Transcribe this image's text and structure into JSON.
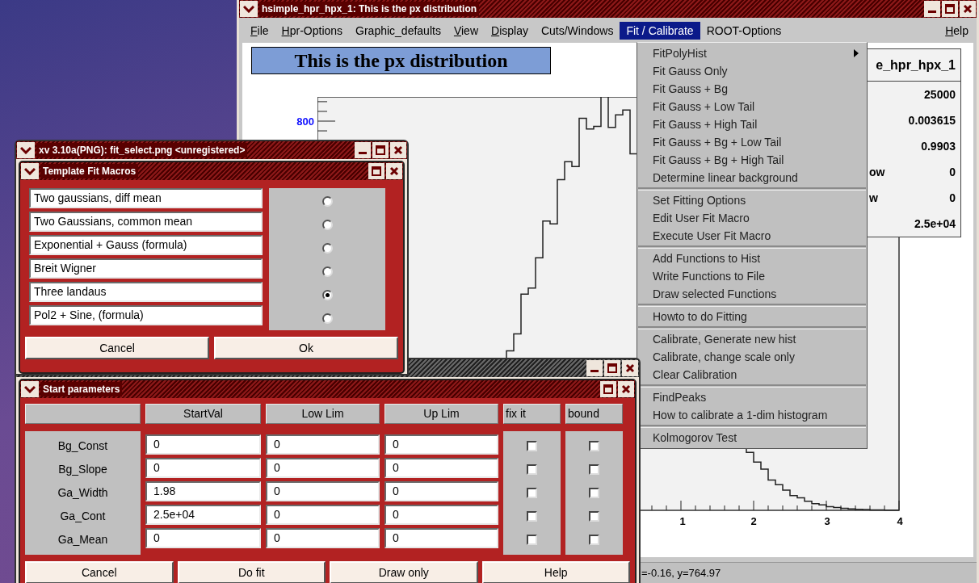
{
  "main_window": {
    "title": "hsimple_hpr_hpx_1: This is the px distribution",
    "menu_bar": [
      {
        "label": "File",
        "underline_first": true,
        "selected": false
      },
      {
        "label": "Hpr-Options",
        "underline_first": true,
        "selected": false
      },
      {
        "label": "Graphic_defaults",
        "underline_first": false,
        "selected": false
      },
      {
        "label": "View",
        "underline_first": true,
        "selected": false
      },
      {
        "label": "Display",
        "underline_first": true,
        "selected": false
      },
      {
        "label": "Cuts/Windows",
        "underline_first": false,
        "selected": false
      },
      {
        "label": "Fit / Calibrate",
        "underline_first": false,
        "selected": true
      },
      {
        "label": "ROOT-Options",
        "underline_first": false,
        "selected": false
      }
    ],
    "help_menu": {
      "label": "Help",
      "underline_first": true
    },
    "canvas": {
      "title_box": "This is the px distribution",
      "stats_box": {
        "title": "e_hpr_hpx_1",
        "rows": [
          {
            "value": "25000"
          },
          {
            "value": "0.003615"
          },
          {
            "value": "0.9903"
          },
          {
            "label": "ow",
            "value": "0"
          },
          {
            "label": "w",
            "value": "0"
          },
          {
            "value": "2.5e+04"
          }
        ]
      },
      "plot": {
        "y_tick_labels": [
          "800"
        ],
        "x_tick_labels": [
          "1",
          "2",
          "3",
          "4"
        ]
      }
    },
    "status_text": "=-0.16, y=764.97"
  },
  "fit_menu": {
    "groups": [
      [
        {
          "label": "FitPolyHist",
          "has_submenu": true
        },
        {
          "label": "Fit Gauss Only",
          "has_submenu": false
        },
        {
          "label": "Fit Gauss + Bg",
          "has_submenu": false
        },
        {
          "label": "Fit Gauss + Low Tail",
          "has_submenu": false
        },
        {
          "label": "Fit Gauss + High Tail",
          "has_submenu": false
        },
        {
          "label": "Fit Gauss + Bg + Low Tail",
          "has_submenu": false
        },
        {
          "label": "Fit Gauss + Bg + High Tail",
          "has_submenu": false
        },
        {
          "label": "Determine linear background",
          "has_submenu": false
        }
      ],
      [
        {
          "label": "Set Fitting Options",
          "has_submenu": false
        },
        {
          "label": "Edit User Fit Macro",
          "has_submenu": false
        },
        {
          "label": "Execute User Fit Macro",
          "has_submenu": false
        }
      ],
      [
        {
          "label": "Add Functions to Hist",
          "has_submenu": false
        },
        {
          "label": "Write Functions to File",
          "has_submenu": false
        },
        {
          "label": "Draw selected Functions",
          "has_submenu": false
        }
      ],
      [
        {
          "label": "Howto to do Fitting",
          "has_submenu": false
        }
      ],
      [
        {
          "label": "Calibrate, Generate new hist",
          "has_submenu": false
        },
        {
          "label": "Calibrate, change scale only",
          "has_submenu": false
        },
        {
          "label": "Clear Calibration",
          "has_submenu": false
        }
      ],
      [
        {
          "label": "FindPeaks",
          "has_submenu": false
        },
        {
          "label": "How to calibrate a 1-dim histogram",
          "has_submenu": false
        }
      ],
      [
        {
          "label": "Kolmogorov Test",
          "has_submenu": false
        }
      ]
    ]
  },
  "xv_window": {
    "title": "xv 3.10a(PNG): fit_select.png <unregistered>",
    "dialog": {
      "title": "Template Fit Macros",
      "macros": [
        {
          "name": "Two gaussians, diff mean",
          "selected": false
        },
        {
          "name": "Two Gaussians, common mean",
          "selected": false
        },
        {
          "name": "Exponential + Gauss (formula)",
          "selected": false
        },
        {
          "name": "Breit Wigner",
          "selected": false
        },
        {
          "name": "Three landaus",
          "selected": true
        },
        {
          "name": "Pol2 + Sine, (formula)",
          "selected": false
        }
      ],
      "buttons": [
        "Cancel",
        "Ok"
      ]
    }
  },
  "start_parameters_window": {
    "dialog": {
      "title": "Start parameters",
      "columns": [
        "StartVal",
        "Low Lim",
        "Up Lim",
        "fix it",
        "bound"
      ],
      "rows": [
        {
          "name": "Bg_Const",
          "start_val": "0",
          "low_lim": "0",
          "up_lim": "0",
          "fix": false,
          "bound": false
        },
        {
          "name": "Bg_Slope",
          "start_val": "0",
          "low_lim": "0",
          "up_lim": "0",
          "fix": false,
          "bound": false
        },
        {
          "name": "Ga_Width",
          "start_val": "1.98",
          "low_lim": "0",
          "up_lim": "0",
          "fix": false,
          "bound": false
        },
        {
          "name": "Ga_Cont",
          "start_val": "2.5e+04",
          "low_lim": "0",
          "up_lim": "0",
          "fix": false,
          "bound": false
        },
        {
          "name": "Ga_Mean",
          "start_val": "0",
          "low_lim": "0",
          "up_lim": "0",
          "fix": false,
          "bound": false
        }
      ],
      "buttons": [
        "Cancel",
        "Do fit",
        "Draw only",
        "Help"
      ]
    }
  }
}
